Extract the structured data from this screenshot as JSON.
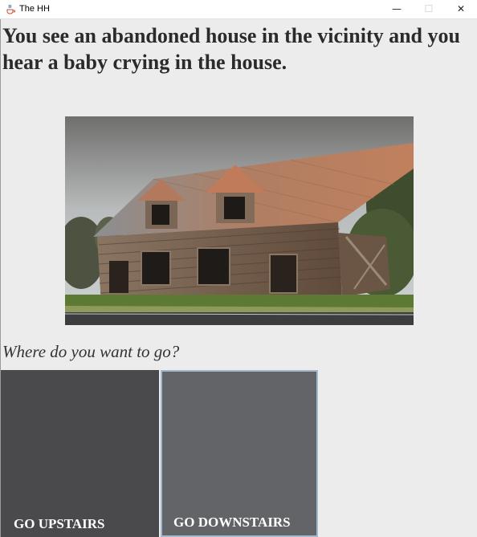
{
  "window": {
    "title": "The HH",
    "icon": "java-cup-icon",
    "minimize_glyph": "—",
    "maximize_glyph": "☐",
    "close_glyph": "✕"
  },
  "story": {
    "text": "You see an abandoned house in the vicinity and you hear a baby crying in the house."
  },
  "scene": {
    "image": "abandoned-house-photo"
  },
  "prompt": {
    "text": "Where do you want to go?"
  },
  "choices": {
    "upstairs_label": "GO UPSTAIRS",
    "downstairs_label": "GO DOWNSTAIRS"
  },
  "colors": {
    "upstairs_button": "#4a4a4c",
    "downstairs_button": "#626467",
    "focus_border": "#a3b8cc"
  }
}
